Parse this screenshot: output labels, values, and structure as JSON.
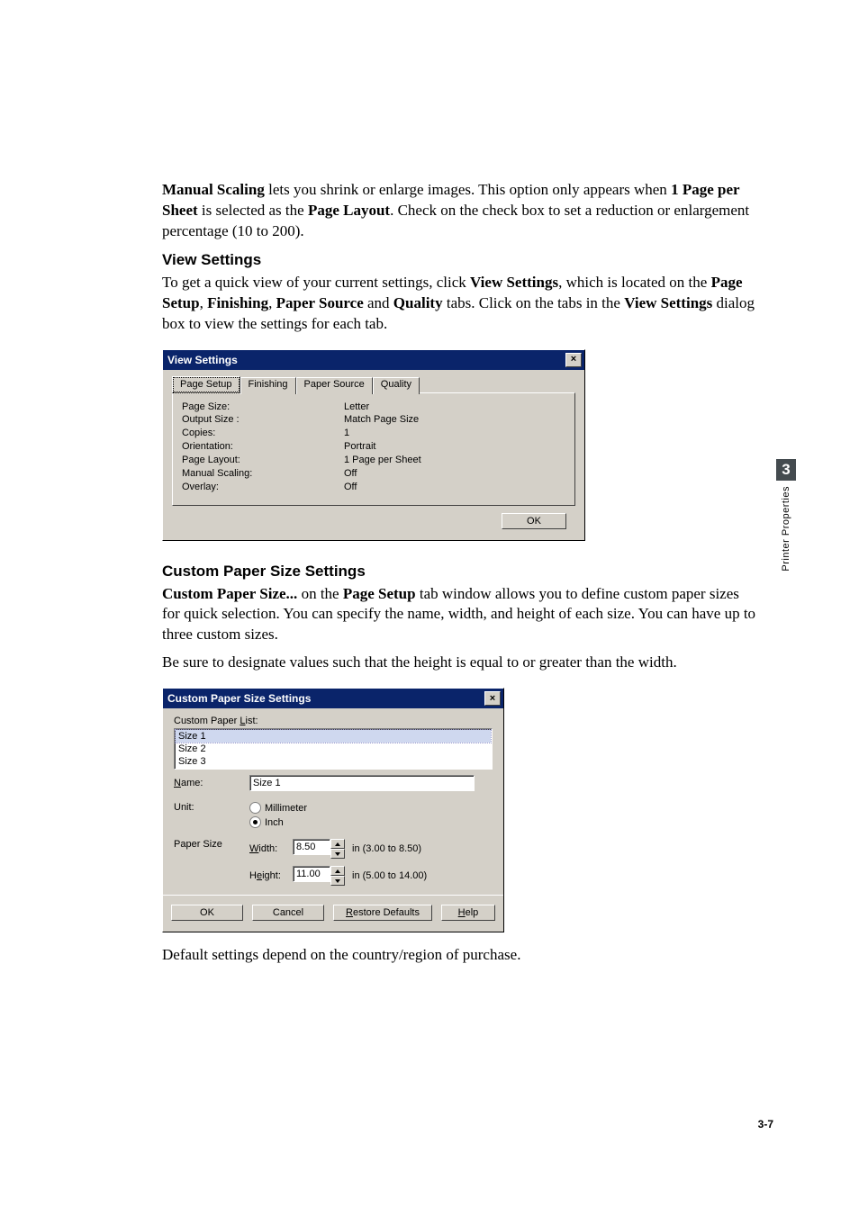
{
  "para_manual_scaling": {
    "b1": "Manual Scaling",
    "t1": " lets you shrink or enlarge images. This option only appears when ",
    "b2": "1 Page per Sheet",
    "t2": " is selected as the ",
    "b3": "Page Layout",
    "t3": ". Check on the check box to set a reduction or enlargement percentage (10 to 200)."
  },
  "heading_view_settings": "View Settings",
  "para_view_settings": {
    "t1": "To get a quick view of your current settings, click ",
    "b1": "View Settings",
    "t2": ", which is located on the ",
    "b2": "Page Setup",
    "t3": ", ",
    "b3": "Finishing",
    "t4": ", ",
    "b4": "Paper Source",
    "t5": " and ",
    "b5": "Quality",
    "t6": " tabs. Click on the tabs in the ",
    "b6": "View Settings",
    "t7": " dialog box to view the settings for each tab."
  },
  "dlg1": {
    "title": "View Settings",
    "close": "×",
    "tabs": [
      "Page Setup",
      "Finishing",
      "Paper Source",
      "Quality"
    ],
    "rows": [
      {
        "k": "Page Size:",
        "v": "Letter"
      },
      {
        "k": "Output Size :",
        "v": "Match Page Size"
      },
      {
        "k": "Copies:",
        "v": "1"
      },
      {
        "k": "Orientation:",
        "v": "Portrait"
      },
      {
        "k": "Page Layout:",
        "v": "1 Page per Sheet"
      },
      {
        "k": "Manual Scaling:",
        "v": "Off"
      },
      {
        "k": "Overlay:",
        "v": "Off"
      }
    ],
    "ok": "OK"
  },
  "heading_custom": "Custom Paper Size Settings",
  "para_custom": {
    "b1": "Custom Paper Size...",
    "t1": " on the ",
    "b2": "Page Setup",
    "t2": " tab window allows you to define custom paper sizes for quick selection. You can specify the name, width, and height of each size. You can have up to three custom sizes."
  },
  "para_custom2": "Be sure to designate values such that the height is equal to or greater than the width.",
  "dlg2": {
    "title": "Custom Paper Size Settings",
    "close": "×",
    "list_label_pre": "Custom Paper ",
    "list_label_u": "L",
    "list_label_post": "ist:",
    "items": [
      "Size 1",
      "Size 2",
      "Size 3"
    ],
    "selected_index": 0,
    "name_label_u": "N",
    "name_label_post": "ame:",
    "name_value": "Size 1",
    "unit_label": "Unit:",
    "unit_mm": "Millimeter",
    "unit_in": "Inch",
    "unit_selected": "in",
    "papersize_label": "Paper Size",
    "width_u": "W",
    "width_post": "idth:",
    "width_val": "8.50",
    "width_range": "in (3.00 to 8.50)",
    "height_pre": "H",
    "height_u": "e",
    "height_post": "ight:",
    "height_val": "11.00",
    "height_range": "in (5.00 to 14.00)",
    "btn_ok": "OK",
    "btn_cancel": "Cancel",
    "btn_restore_u": "R",
    "btn_restore_post": "estore Defaults",
    "btn_help_u": "H",
    "btn_help_post": "elp"
  },
  "para_default": "Default settings depend on the country/region of purchase.",
  "side": {
    "num": "3",
    "label": "Printer Properties"
  },
  "page_num": "3-7"
}
